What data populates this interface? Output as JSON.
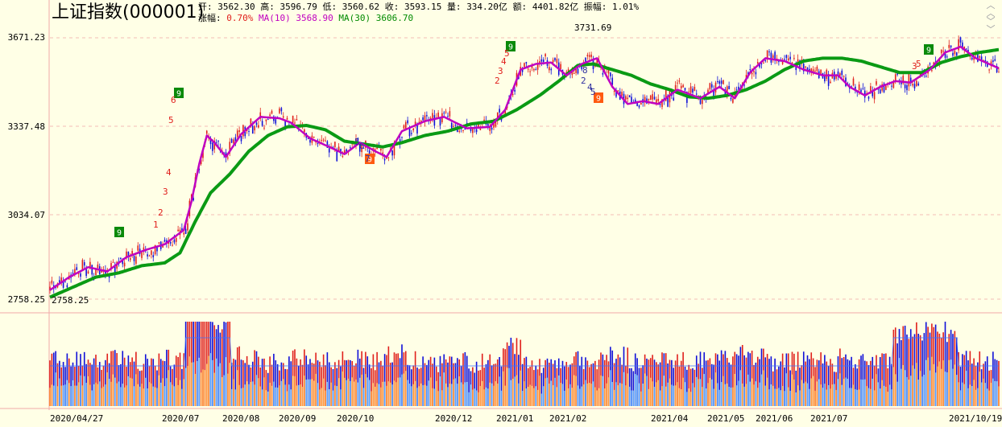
{
  "header": {
    "title": "上证指数(000001)",
    "open_label": "开:",
    "open": "3562.30",
    "high_label": "高:",
    "high": "3596.79",
    "low_label": "低:",
    "low": "3560.62",
    "close_label": "收:",
    "close": "3593.15",
    "volume_label": "量:",
    "volume": "334.20亿",
    "amount_label": "额:",
    "amount": "4401.82亿",
    "amplitude_label": "振幅:",
    "amplitude": "1.01%",
    "change_label": "涨幅:",
    "change": "0.70%",
    "ma10_label": "MA(10)",
    "ma10": "3568.90",
    "ma30_label": "MA(30)",
    "ma30": "3606.70"
  },
  "colors": {
    "background": "#ffffe6",
    "up": "#e0201c",
    "down": "#1010d8",
    "ma10": "#c000c0",
    "ma30": "#0a9a14",
    "grid": "#f0a8a8",
    "td_green": "#0a8a0a",
    "td_orange": "#ff5a10",
    "td_down_num": "#3030a0"
  },
  "icons": {
    "scroll": "double-chevron-icon"
  },
  "chart_data": {
    "type": "candlestick",
    "y_ticks": [
      "3671.23",
      "3337.48",
      "3034.07",
      "2758.25"
    ],
    "ylim": [
      2758.25,
      3671.23
    ],
    "x_labels": [
      "2020/04/27",
      "2020/07",
      "2020/08",
      "2020/09",
      "2020/10",
      "2020/12",
      "2021/01",
      "2021/02",
      "2021/04",
      "2021/05",
      "2021/06",
      "2021/07",
      "2021/10/19"
    ],
    "annotations": {
      "max": "3731.69",
      "min": "2758.25"
    },
    "series": [
      {
        "name": "MA(10)",
        "anchors": [
          [
            0,
            2790
          ],
          [
            10,
            2835
          ],
          [
            20,
            2870
          ],
          [
            30,
            2855
          ],
          [
            40,
            2905
          ],
          [
            50,
            2930
          ],
          [
            60,
            2950
          ],
          [
            70,
            3000
          ],
          [
            74,
            3100
          ],
          [
            78,
            3230
          ],
          [
            82,
            3330
          ],
          [
            86,
            3305
          ],
          [
            92,
            3255
          ],
          [
            100,
            3335
          ],
          [
            110,
            3395
          ],
          [
            120,
            3390
          ],
          [
            126,
            3375
          ],
          [
            136,
            3320
          ],
          [
            146,
            3290
          ],
          [
            154,
            3265
          ],
          [
            162,
            3305
          ],
          [
            170,
            3275
          ],
          [
            176,
            3255
          ],
          [
            184,
            3345
          ],
          [
            196,
            3380
          ],
          [
            206,
            3395
          ],
          [
            218,
            3355
          ],
          [
            230,
            3360
          ],
          [
            238,
            3420
          ],
          [
            246,
            3560
          ],
          [
            254,
            3580
          ],
          [
            262,
            3585
          ],
          [
            270,
            3540
          ],
          [
            278,
            3580
          ],
          [
            286,
            3600
          ],
          [
            294,
            3500
          ],
          [
            302,
            3440
          ],
          [
            310,
            3450
          ],
          [
            318,
            3440
          ],
          [
            328,
            3490
          ],
          [
            340,
            3460
          ],
          [
            350,
            3500
          ],
          [
            358,
            3460
          ],
          [
            366,
            3550
          ],
          [
            374,
            3600
          ],
          [
            384,
            3590
          ],
          [
            394,
            3560
          ],
          [
            404,
            3540
          ],
          [
            412,
            3540
          ],
          [
            418,
            3500
          ],
          [
            426,
            3470
          ],
          [
            434,
            3500
          ],
          [
            442,
            3520
          ],
          [
            450,
            3515
          ],
          [
            460,
            3560
          ],
          [
            468,
            3620
          ],
          [
            476,
            3640
          ],
          [
            484,
            3600
          ],
          [
            496,
            3565
          ]
        ]
      },
      {
        "name": "MA(30)",
        "anchors": [
          [
            0,
            2765
          ],
          [
            12,
            2800
          ],
          [
            24,
            2835
          ],
          [
            36,
            2850
          ],
          [
            48,
            2875
          ],
          [
            60,
            2885
          ],
          [
            68,
            2920
          ],
          [
            76,
            3030
          ],
          [
            84,
            3130
          ],
          [
            94,
            3195
          ],
          [
            104,
            3275
          ],
          [
            114,
            3330
          ],
          [
            124,
            3360
          ],
          [
            134,
            3365
          ],
          [
            144,
            3350
          ],
          [
            154,
            3310
          ],
          [
            164,
            3300
          ],
          [
            174,
            3290
          ],
          [
            184,
            3305
          ],
          [
            196,
            3330
          ],
          [
            208,
            3345
          ],
          [
            220,
            3370
          ],
          [
            232,
            3380
          ],
          [
            244,
            3420
          ],
          [
            256,
            3470
          ],
          [
            266,
            3520
          ],
          [
            276,
            3575
          ],
          [
            284,
            3580
          ],
          [
            294,
            3560
          ],
          [
            304,
            3540
          ],
          [
            314,
            3510
          ],
          [
            324,
            3490
          ],
          [
            334,
            3465
          ],
          [
            344,
            3460
          ],
          [
            354,
            3470
          ],
          [
            364,
            3490
          ],
          [
            374,
            3520
          ],
          [
            384,
            3560
          ],
          [
            394,
            3590
          ],
          [
            404,
            3600
          ],
          [
            414,
            3600
          ],
          [
            424,
            3590
          ],
          [
            434,
            3570
          ],
          [
            444,
            3550
          ],
          [
            456,
            3550
          ],
          [
            466,
            3585
          ],
          [
            476,
            3605
          ],
          [
            486,
            3620
          ],
          [
            496,
            3630
          ]
        ]
      }
    ]
  }
}
